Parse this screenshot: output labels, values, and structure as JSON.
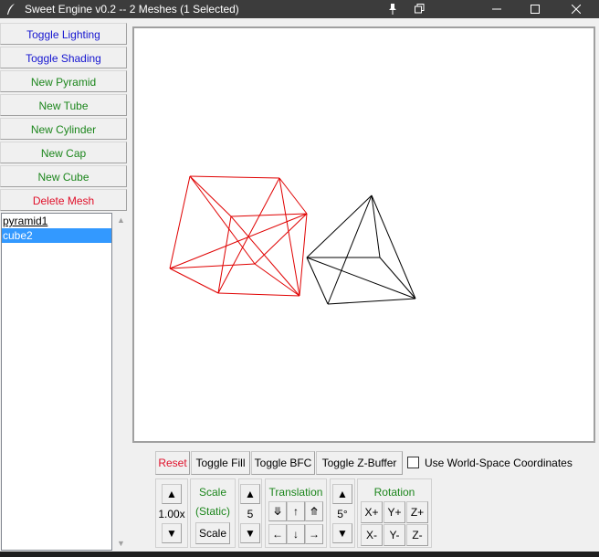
{
  "window": {
    "title": "Sweet Engine v0.2 -- 2 Meshes (1 Selected)"
  },
  "colors": {
    "render_selected": "#e00000",
    "render_default": "#000000",
    "blue_text": "#1515d0",
    "green_text": "#1c861c",
    "red_text": "#e0102a",
    "list_selection": "#3399ff"
  },
  "sidebar": {
    "toggle_lighting": "Toggle Lighting",
    "toggle_shading": "Toggle Shading",
    "new_pyramid": "New Pyramid",
    "new_tube": "New Tube",
    "new_cylinder": "New Cylinder",
    "new_cap": "New Cap",
    "new_cube": "New Cube",
    "delete_mesh": "Delete Mesh"
  },
  "mesh_list": {
    "items": [
      "pyramid1",
      "cube2"
    ],
    "selected": "cube2"
  },
  "viewport": {
    "meshes": [
      "cube2",
      "pyramid1"
    ]
  },
  "options_bar": {
    "reset": "Reset",
    "toggle_fill": "Toggle Fill",
    "toggle_bfc": "Toggle BFC",
    "toggle_zbuffer": "Toggle Z-Buffer",
    "world_space_label": "Use World-Space Coordinates",
    "world_space_checked": false
  },
  "controls": {
    "up_arrow": "▲",
    "down_arrow": "▼",
    "scale_value": "1.00x",
    "scale_label_1": "Scale",
    "scale_label_2": "(Static)",
    "scale_button": "Scale",
    "step_value": "5",
    "translation_label": "Translation",
    "translation": {
      "z_up": "⤋",
      "up": "↑",
      "z_down": "⤊",
      "left": "←",
      "down": "↓",
      "right": "→"
    },
    "angle_value": "5°",
    "rotation_label": "Rotation",
    "rotation": {
      "x_plus": "X+",
      "y_plus": "Y+",
      "z_plus": "Z+",
      "x_minus": "X-",
      "y_minus": "Y-",
      "z_minus": "Z-"
    }
  }
}
